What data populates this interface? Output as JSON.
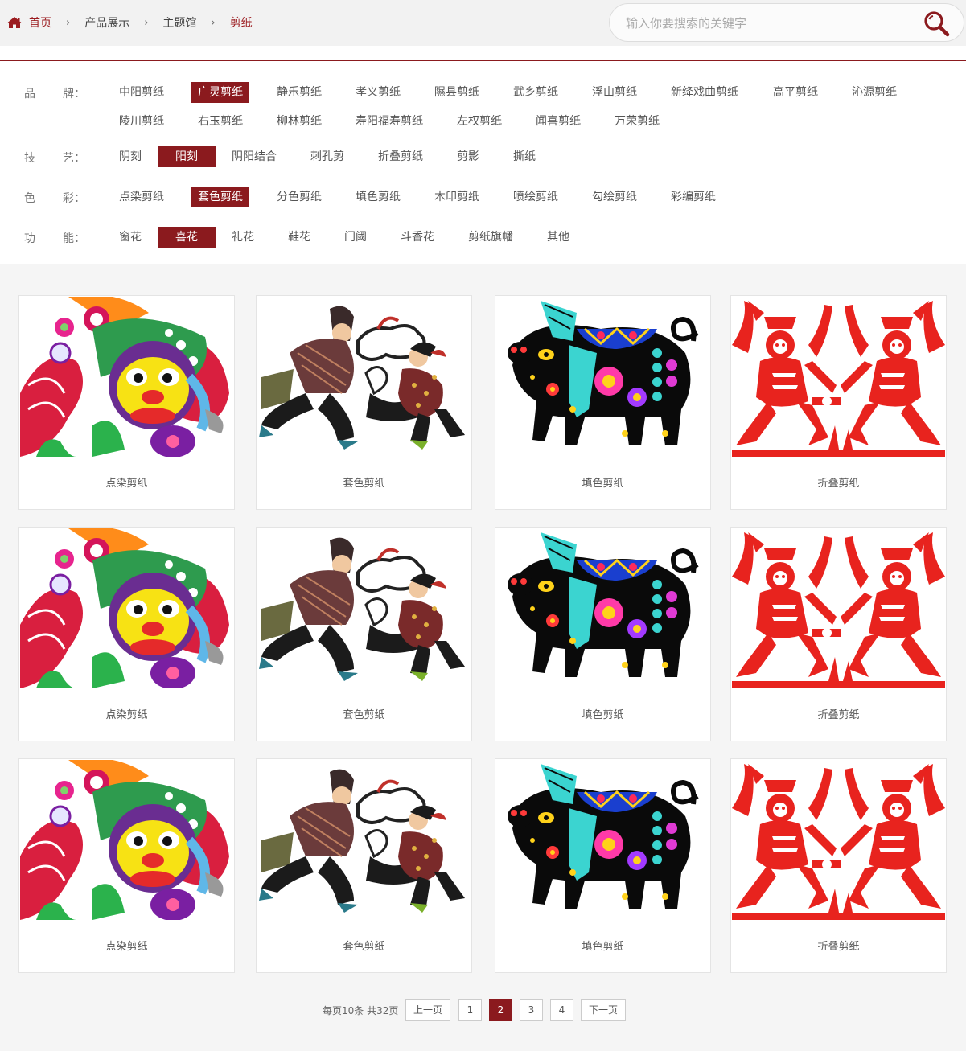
{
  "breadcrumb": {
    "items": [
      "首页",
      "产品展示",
      "主题馆",
      "剪纸"
    ],
    "separator": "›"
  },
  "search": {
    "placeholder": "输入你要搜索的关键字"
  },
  "colors": {
    "accent": "#8b1a1e",
    "background": "#f5f5f5"
  },
  "filters": [
    {
      "label": [
        "品",
        "牌："
      ],
      "options": [
        "中阳剪纸",
        "广灵剪纸",
        "静乐剪纸",
        "孝义剪纸",
        "隰县剪纸",
        "武乡剪纸",
        "浮山剪纸",
        "新绛戏曲剪纸",
        "高平剪纸",
        "沁源剪纸",
        "陵川剪纸",
        "右玉剪纸",
        "柳林剪纸",
        "寿阳福寿剪纸",
        "左权剪纸",
        "闻喜剪纸",
        "万荣剪纸"
      ],
      "selected": "广灵剪纸"
    },
    {
      "label": [
        "技",
        "艺："
      ],
      "options": [
        "阴刻",
        "阳刻",
        "阴阳结合",
        "刺孔剪",
        "折叠剪纸",
        "剪影",
        "撕纸"
      ],
      "selected": "阳刻"
    },
    {
      "label": [
        "色",
        "彩："
      ],
      "options": [
        "点染剪纸",
        "套色剪纸",
        "分色剪纸",
        "填色剪纸",
        "木印剪纸",
        "喷绘剪纸",
        "勾绘剪纸",
        "彩编剪纸"
      ],
      "selected": "套色剪纸"
    },
    {
      "label": [
        "功",
        "能："
      ],
      "options": [
        "窗花",
        "喜花",
        "礼花",
        "鞋花",
        "门阈",
        "斗香花",
        "剪纸旗幡",
        "其他"
      ],
      "selected": "喜花"
    }
  ],
  "products": [
    {
      "caption": "点染剪纸",
      "icon": "lion-papercut"
    },
    {
      "caption": "套色剪纸",
      "icon": "children-papercut"
    },
    {
      "caption": "填色剪纸",
      "icon": "pig-papercut"
    },
    {
      "caption": "折叠剪纸",
      "icon": "red-figures-papercut"
    },
    {
      "caption": "点染剪纸",
      "icon": "lion-papercut"
    },
    {
      "caption": "套色剪纸",
      "icon": "children-papercut"
    },
    {
      "caption": "填色剪纸",
      "icon": "pig-papercut"
    },
    {
      "caption": "折叠剪纸",
      "icon": "red-figures-papercut"
    },
    {
      "caption": "点染剪纸",
      "icon": "lion-papercut"
    },
    {
      "caption": "套色剪纸",
      "icon": "children-papercut"
    },
    {
      "caption": "填色剪纸",
      "icon": "pig-papercut"
    },
    {
      "caption": "折叠剪纸",
      "icon": "red-figures-papercut"
    }
  ],
  "pagination": {
    "info": "每页10条 共32页",
    "prev": "上一页",
    "pages": [
      "1",
      "2",
      "3",
      "4"
    ],
    "current": "2",
    "next": "下一页"
  }
}
